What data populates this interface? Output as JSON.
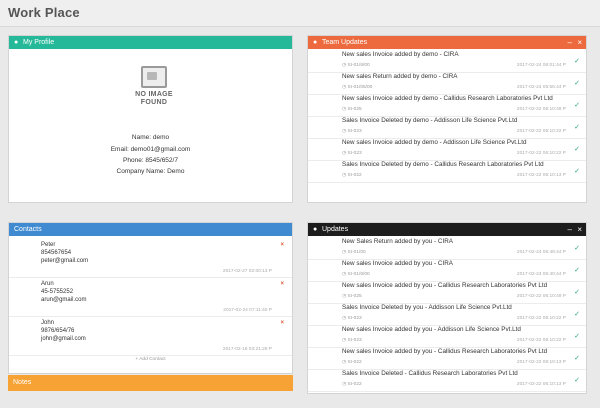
{
  "page": {
    "title": "Work Place"
  },
  "profile": {
    "header": "My Profile",
    "no_image": [
      "NO IMAGE",
      "FOUND"
    ],
    "name": "Name: demo",
    "email": "Email: demo01@gmail.com",
    "phone": "Phone: 8545/652/7",
    "company": "Company Name: Demo"
  },
  "team_updates": {
    "header": "Team Updates",
    "items": [
      {
        "title": "New sales Invoice added by demo - CIRA",
        "sub": "SI-01/6/00",
        "time": "2017-02-24 06:01:44 P"
      },
      {
        "title": "New sales Return added by demo - CIRA",
        "sub": "SI-01/05/00",
        "time": "2017-02-24 05:55:44 P"
      },
      {
        "title": "New sales Invoice added by demo - Callidus Research Laboratories Pvt Ltd",
        "sub": "SI-025",
        "time": "2017-02-22 06:10:49 P"
      },
      {
        "title": "Sales Invoice Deleted by demo - Addisson Life Science Pvt.Ltd",
        "sub": "SI-023",
        "time": "2017-02-22 06:10:22 P"
      },
      {
        "title": "New sales Invoice added by demo - Addisson Life Science Pvt.Ltd",
        "sub": "SI-023",
        "time": "2017-02-22 06:10:22 P"
      },
      {
        "title": "Sales Invoice Deleted by demo - Callidus Research Laboratories Pvt Ltd",
        "sub": "SI-022",
        "time": "2017-02-22 06:10:13 P"
      }
    ]
  },
  "contacts": {
    "header": "Contacts",
    "items": [
      {
        "name": "Peter",
        "phone": "854567654",
        "email": "peter@gmail.com",
        "time": "2017-02-27 02:00:13 P"
      },
      {
        "name": "Arun",
        "phone": "45-5755252",
        "email": "arun@gmail.com",
        "time": "2017-02-24 07:11:40 P"
      },
      {
        "name": "John",
        "phone": "9876/654/76",
        "email": "john@gmail.com",
        "time": "2017-02-16 03:21:29 P"
      }
    ],
    "footer": "+ Add Contact"
  },
  "notes": {
    "header": "Notes"
  },
  "updates": {
    "header": "Updates",
    "items": [
      {
        "title": "New Sales Return added by you - CIRA",
        "sub": "SI-01/00",
        "time": "2017-02-24 05:48:44 P"
      },
      {
        "title": "New sales Invoice added by you - CIRA",
        "sub": "SI-01/6/00",
        "time": "2017-02-24 05:40:44 P"
      },
      {
        "title": "New sales Invoice added by you - Callidus Research Laboratories Pvt Ltd",
        "sub": "SI-025",
        "time": "2017-02-22 06:10:49 P"
      },
      {
        "title": "Sales Invoice Deleted by you - Addisson Life Science Pvt.Ltd",
        "sub": "SI-023",
        "time": "2017-02-22 06:10:22 P"
      },
      {
        "title": "New sales Invoice added by you - Addisson Life Science Pvt.Ltd",
        "sub": "SI-023",
        "time": "2017-02-22 06:10:22 P"
      },
      {
        "title": "New sales Invoice added by you - Callidus Research Laboratories Pvt Ltd",
        "sub": "SI-022",
        "time": "2017-02-22 06:10:13 P"
      },
      {
        "title": "Sales Invoice Deleted - Callidus Research Laboratories Pvt Ltd",
        "sub": "SI-022",
        "time": "2017-02-22 06:10:13 P"
      }
    ]
  },
  "colors": {
    "profile": "#26b999",
    "team": "#ec6a3e",
    "contacts": "#3f8ad0",
    "notes": "#f7a234",
    "updates": "#1d1d1d",
    "check": "#2aa872"
  },
  "icons": {
    "profile": "user-icon",
    "team": "users-icon",
    "contacts": "contacts-icon",
    "updates": "bell-icon",
    "row": "clock-icon",
    "check": "check-icon",
    "remove": "close-icon"
  }
}
